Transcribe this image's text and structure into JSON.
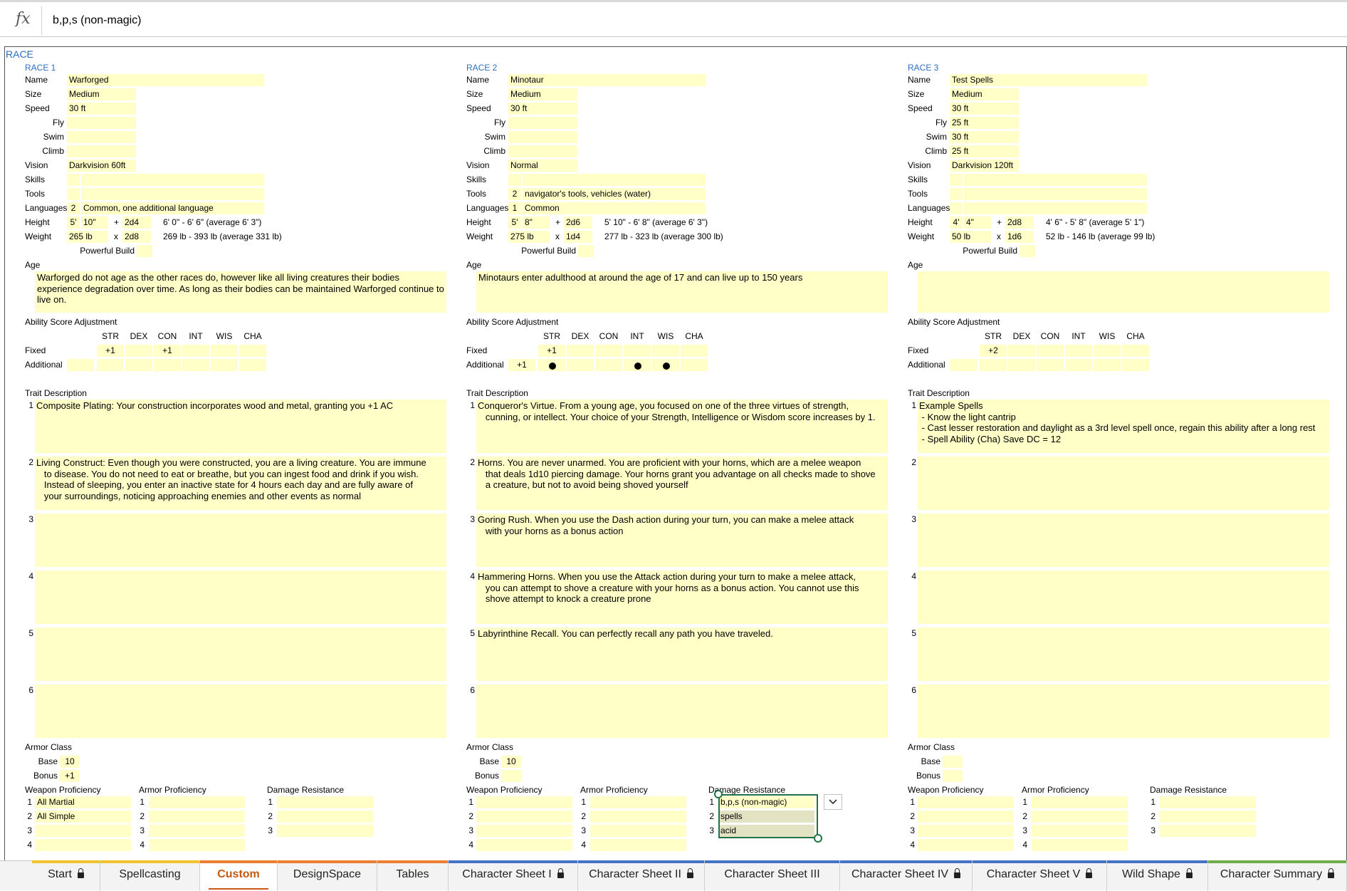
{
  "formula_bar": {
    "fx": "fx",
    "value": "b,p,s (non-magic)"
  },
  "section_title": "RACE",
  "labels": {
    "name": "Name",
    "size": "Size",
    "speed": "Speed",
    "fly": "Fly",
    "swim": "Swim",
    "climb": "Climb",
    "vision": "Vision",
    "skills": "Skills",
    "tools": "Tools",
    "languages": "Languages",
    "height": "Height",
    "weight": "Weight",
    "powerful_build": "Powerful Build",
    "age": "Age",
    "asa": "Ability Score Adjustment",
    "fixed": "Fixed",
    "additional": "Additional",
    "trait_description": "Trait Description",
    "armor_class": "Armor Class",
    "base": "Base",
    "bonus": "Bonus",
    "weapon_proficiency": "Weapon Proficiency",
    "armor_proficiency": "Armor Proficiency",
    "damage_resistance": "Damage Resistance",
    "plus": "+",
    "times": "x",
    "abilities": [
      "STR",
      "DEX",
      "CON",
      "INT",
      "WIS",
      "CHA"
    ],
    "trait_numbers": [
      "1",
      "2",
      "3",
      "4",
      "5",
      "6"
    ],
    "prof_numbers": [
      "1",
      "2",
      "3",
      "4"
    ],
    "dr_numbers": [
      "1",
      "2",
      "3"
    ]
  },
  "races": [
    {
      "header": "RACE 1",
      "name": "Warforged",
      "size": "Medium",
      "speed": "30 ft",
      "fly": "",
      "swim": "",
      "climb": "",
      "vision": "Darkvision 60ft",
      "skills_count": "",
      "skills": "",
      "tools_count": "",
      "tools": "",
      "languages_count": "2",
      "languages": "Common, one additional language",
      "height_ft": "5'",
      "height_in": "10\"",
      "height_dice": "2d4",
      "height_range": "6' 0\" - 6' 6\" (average 6' 3\")",
      "weight_base": "265 lb",
      "weight_dice": "2d8",
      "weight_range": "269 lb - 393 lb (average 331 lb)",
      "powerful_build": "",
      "age": "Warforged do not age as the other races do, however like all living creatures their bodies experience degradation over time. As long as their bodies can be maintained Warforged continue to live on.",
      "fixed": [
        "+1",
        "",
        "+1",
        "",
        "",
        ""
      ],
      "additional_value": "",
      "additional": [
        "",
        "",
        "",
        "",
        "",
        ""
      ],
      "traits": [
        "Composite Plating: Your construction incorporates wood and metal, granting you +1 AC",
        "Living Construct: Even though you were constructed, you are a living creature. You are immune\n   to disease. You do not need to eat or breathe, but you can ingest food and drink if you wish.\n   Instead of sleeping, you enter an inactive state for 4 hours each day and are fully aware of\n   your surroundings, noticing approaching enemies and other events as normal",
        "",
        "",
        "",
        ""
      ],
      "ac_base": "10",
      "ac_bonus": "+1",
      "weapon_prof": [
        "All Martial",
        "All Simple",
        "",
        ""
      ],
      "armor_prof": [
        "",
        "",
        "",
        ""
      ],
      "damage_res": [
        "",
        "",
        ""
      ]
    },
    {
      "header": "RACE 2",
      "name": "Minotaur",
      "size": "Medium",
      "speed": "30 ft",
      "fly": "",
      "swim": "",
      "climb": "",
      "vision": "Normal",
      "skills_count": "",
      "skills": "",
      "tools_count": "2",
      "tools": "navigator's tools, vehicles (water)",
      "languages_count": "1",
      "languages": "Common",
      "height_ft": "5'",
      "height_in": "8\"",
      "height_dice": "2d6",
      "height_range": "5' 10\" - 6' 8\" (average 6' 3\")",
      "weight_base": "275 lb",
      "weight_dice": "1d4",
      "weight_range": "277 lb - 323 lb (average 300 lb)",
      "powerful_build": "",
      "age": "Minotaurs enter adulthood at around the age of 17 and can live up to 150 years",
      "fixed": [
        "+1",
        "",
        "",
        "",
        "",
        ""
      ],
      "additional_value": "+1",
      "additional": [
        "●",
        "",
        "",
        "●",
        "●",
        ""
      ],
      "traits": [
        "Conqueror's Virtue. From a young age, you focused on one of the three virtues of strength,\n   cunning, or intellect. Your choice of your Strength, Intelligence or Wisdom score increases by 1.",
        "Horns. You are never unarmed. You are proficient with your horns, which are a melee weapon\n   that deals 1d10 piercing damage. Your horns grant you advantage on all checks made to shove\n   a creature, but not to avoid being shoved yourself",
        "Goring Rush. When you use the Dash action during your turn, you can make a melee attack\n   with your horns as a bonus action",
        "Hammering Horns. When you use the Attack action during your turn to make a melee attack,\n   you can attempt to shove a creature with your horns as a bonus action. You cannot use this\n   shove attempt to knock a creature prone",
        "Labyrinthine Recall. You can perfectly recall any path you have traveled.",
        ""
      ],
      "ac_base": "10",
      "ac_bonus": "",
      "weapon_prof": [
        "",
        "",
        "",
        ""
      ],
      "armor_prof": [
        "",
        "",
        "",
        ""
      ],
      "damage_res": [
        "b,p,s (non-magic)",
        "spells",
        "acid"
      ]
    },
    {
      "header": "RACE 3",
      "name": "Test Spells",
      "size": "Medium",
      "speed": "30 ft",
      "fly": "25 ft",
      "swim": "30 ft",
      "climb": "25 ft",
      "vision": "Darkvision 120ft",
      "skills_count": "",
      "skills": "",
      "tools_count": "",
      "tools": "",
      "languages_count": "",
      "languages": "",
      "height_ft": "4'",
      "height_in": "4\"",
      "height_dice": "2d8",
      "height_range": "4' 6\" - 5' 8\" (average 5' 1\")",
      "weight_base": "50 lb",
      "weight_dice": "1d6",
      "weight_range": "52 lb - 146 lb (average 99 lb)",
      "powerful_build": "",
      "age": "",
      "fixed": [
        "+2",
        "",
        "",
        "",
        "",
        ""
      ],
      "additional_value": "",
      "additional": [
        "",
        "",
        "",
        "",
        "",
        ""
      ],
      "traits": [
        "Example Spells\n - Know the light cantrip\n - Cast lesser restoration and daylight as a 3rd level spell once, regain this ability after a long rest\n - Spell Ability (Cha) Save DC = 12",
        "",
        "",
        "",
        "",
        ""
      ],
      "ac_base": "",
      "ac_bonus": "",
      "weapon_prof": [
        "",
        "",
        "",
        ""
      ],
      "armor_prof": [
        "",
        "",
        "",
        ""
      ],
      "damage_res": [
        "",
        "",
        ""
      ]
    }
  ],
  "tabs": [
    {
      "label": "Start",
      "locked": true,
      "color": "#f2c12e",
      "active": false
    },
    {
      "label": "Spellcasting",
      "locked": false,
      "color": "#f2c12e",
      "active": false
    },
    {
      "label": "Custom",
      "locked": false,
      "color": "#ed7d31",
      "active": true
    },
    {
      "label": "DesignSpace",
      "locked": false,
      "color": "#ed7d31",
      "active": false
    },
    {
      "label": "Tables",
      "locked": false,
      "color": "#ed7d31",
      "active": false
    },
    {
      "label": "Character Sheet I",
      "locked": true,
      "color": "#4472c4",
      "active": false
    },
    {
      "label": "Character Sheet II",
      "locked": true,
      "color": "#4472c4",
      "active": false
    },
    {
      "label": "Character Sheet III",
      "locked": false,
      "color": "#4472c4",
      "active": false
    },
    {
      "label": "Character Sheet IV",
      "locked": true,
      "color": "#4472c4",
      "active": false
    },
    {
      "label": "Character Sheet V",
      "locked": true,
      "color": "#4472c4",
      "active": false
    },
    {
      "label": "Wild Shape",
      "locked": true,
      "color": "#4472c4",
      "active": false
    },
    {
      "label": "Character Summary",
      "locked": true,
      "color": "#70ad47",
      "active": false
    }
  ]
}
